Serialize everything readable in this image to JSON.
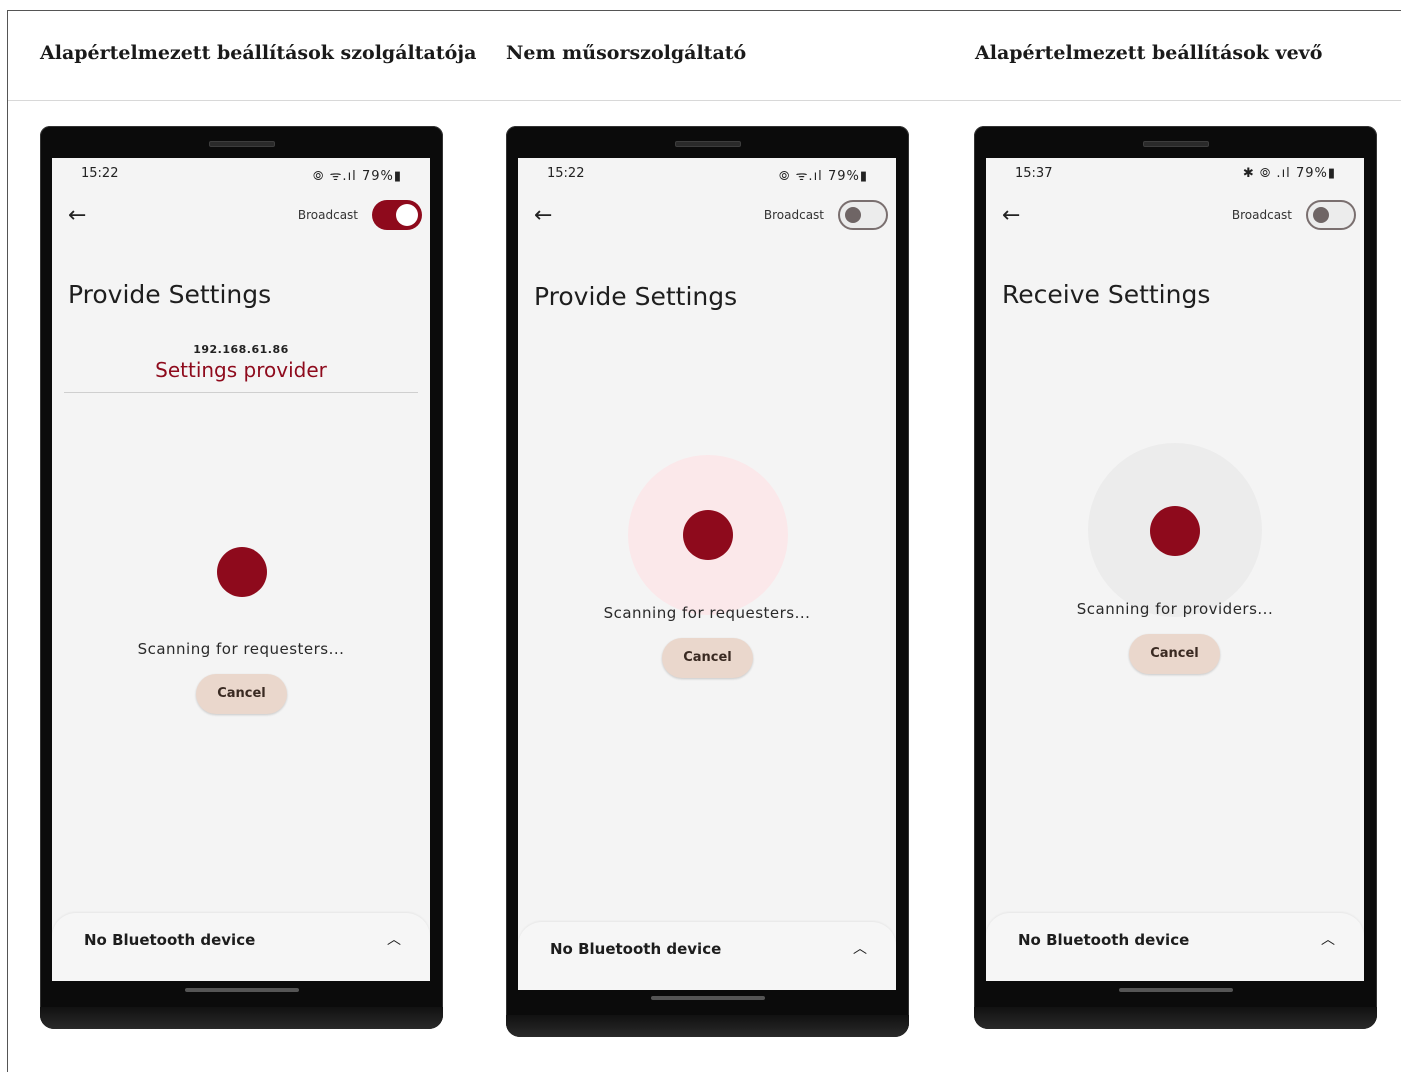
{
  "columns": [
    {
      "header": "Alapértelmezett beállítások szolgáltatója",
      "phone": {
        "time": "15:22",
        "status_icons": "⦾ ᯤ.ıl",
        "battery": "79%",
        "broadcast_label": "Broadcast",
        "broadcast_on": true,
        "title": "Provide Settings",
        "ip": "192.168.61.86",
        "provider_name": "Settings provider",
        "scan_text": "Scanning for requesters...",
        "cancel": "Cancel",
        "bt_text": "No Bluetooth device"
      }
    },
    {
      "header": "Nem műsorszolgáltató",
      "phone": {
        "time": "15:22",
        "status_icons": "⦾ ᯤ.ıl",
        "battery": "79%",
        "broadcast_label": "Broadcast",
        "broadcast_on": false,
        "title": "Provide Settings",
        "scan_text": "Scanning for requesters...",
        "cancel": "Cancel",
        "bt_text": "No Bluetooth device"
      }
    },
    {
      "header": "Alapértelmezett beállítások vevő",
      "phone": {
        "time": "15:37",
        "status_icons": "✱ ⦾ .ıl",
        "battery": "79%",
        "broadcast_label": "Broadcast",
        "broadcast_on": false,
        "title": "Receive Settings",
        "scan_text": "Scanning for providers...",
        "cancel": "Cancel",
        "bt_text": "No Bluetooth device"
      }
    }
  ],
  "colors": {
    "accent": "#8e0a1c",
    "cancel_bg": "#ead7cc",
    "screen_bg": "#f4f4f4",
    "halo_pink": "#fbe8ea",
    "halo_grey": "#ececec"
  }
}
